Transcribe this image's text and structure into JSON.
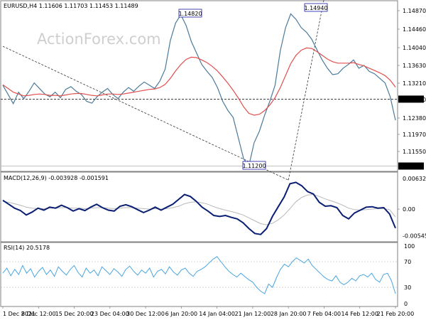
{
  "chart_data": [
    {
      "panel": "price",
      "type": "line",
      "title": "EURUSD,H4  1.11606 1.11703 1.11453 1.11489",
      "watermark": "ActionForex.com",
      "ylim": [
        1.1138,
        1.149
      ],
      "y_ticks": [
        "1.14870",
        "1.14460",
        "1.14040",
        "1.13630",
        "1.13210",
        "1.12800",
        "1.12380",
        "1.11970",
        "1.11550"
      ],
      "x": [
        "1 Dec 2021",
        "8 Dec 12:00",
        "15 Dec 20:00",
        "23 Dec 04:00",
        "30 Dec 12:00",
        "6 Jan 20:00",
        "14 Jan 04:00",
        "21 Jan 12:00",
        "28 Jan 20:00",
        "7 Feb 04:00",
        "14 Feb 12:00",
        "21 Feb 20:00"
      ],
      "series": [
        {
          "name": "close",
          "values": [
            1.1325,
            1.1305,
            1.1285,
            1.131,
            1.1296,
            1.1312,
            1.133,
            1.1318,
            1.1306,
            1.13,
            1.131,
            1.1298,
            1.1316,
            1.1322,
            1.1312,
            1.1305,
            1.129,
            1.1286,
            1.13,
            1.131,
            1.1318,
            1.1305,
            1.1296,
            1.131,
            1.132,
            1.1312,
            1.1323,
            1.1332,
            1.1325,
            1.1318,
            1.1334,
            1.136,
            1.1422,
            1.146,
            1.1478,
            1.1455,
            1.142,
            1.1395,
            1.137,
            1.1355,
            1.1342,
            1.132,
            1.129,
            1.127,
            1.1255,
            1.121,
            1.1165,
            1.115,
            1.12,
            1.1225,
            1.126,
            1.129,
            1.1325,
            1.14,
            1.145,
            1.148,
            1.1468,
            1.145,
            1.144,
            1.1425,
            1.1402,
            1.138,
            1.1362,
            1.1348,
            1.135,
            1.1362,
            1.137,
            1.138,
            1.1362,
            1.1368,
            1.1355,
            1.135,
            1.134,
            1.133,
            1.13,
            1.1249
          ]
        },
        {
          "name": "SMA",
          "values": [
            1.1326,
            1.1318,
            1.131,
            1.1306,
            1.1302,
            1.1303,
            1.1305,
            1.1306,
            1.1305,
            1.1303,
            1.1303,
            1.1302,
            1.1304,
            1.1306,
            1.1307,
            1.1307,
            1.1305,
            1.1303,
            1.1302,
            1.1304,
            1.1306,
            1.1306,
            1.1305,
            1.1306,
            1.1308,
            1.131,
            1.1312,
            1.1314,
            1.1316,
            1.1317,
            1.132,
            1.1327,
            1.134,
            1.1356,
            1.137,
            1.1381,
            1.1386,
            1.1385,
            1.138,
            1.1374,
            1.1366,
            1.1356,
            1.1343,
            1.1329,
            1.1314,
            1.1297,
            1.1278,
            1.1264,
            1.126,
            1.1262,
            1.127,
            1.1282,
            1.1298,
            1.132,
            1.1346,
            1.1372,
            1.139,
            1.1401,
            1.1406,
            1.1405,
            1.1398,
            1.139,
            1.1382,
            1.1376,
            1.1373,
            1.1373,
            1.1373,
            1.1374,
            1.137,
            1.1367,
            1.1362,
            1.1357,
            1.1352,
            1.1346,
            1.1336,
            1.1321
          ]
        }
      ],
      "current_price": {
        "label": "1.11489",
        "value": 1.1149
      },
      "reference_level": {
        "label": "1.12870",
        "value": 1.1287
      },
      "annotations": [
        {
          "label": "1.14820",
          "value": 1.1482
        },
        {
          "label": "1.14940",
          "value": 1.1494
        },
        {
          "label": "1.11200",
          "value": 1.112
        }
      ],
      "trendlines": [
        {
          "from_x": "1 Dec 2021",
          "from_y": 1.1396,
          "to_x": "28 Jan 20:00",
          "to_y": 1.112
        },
        {
          "from_x": "28 Jan 20:00",
          "from_y": 1.112,
          "to_x": "7 Feb 04:00",
          "to_y": 1.1494
        }
      ]
    },
    {
      "panel": "macd",
      "type": "line",
      "title": "MACD(12,26,9) -0.003928 -0.001591",
      "ylim": [
        -0.0067,
        0.0076
      ],
      "y_ticks": [
        "0.00632",
        "0.00",
        "-0.005455"
      ],
      "series": [
        {
          "name": "MACD",
          "values": [
            0.0018,
            0.001,
            0.0002,
            -0.0003,
            -0.0012,
            -0.0006,
            0.0002,
            -0.0002,
            0.0004,
            0.0002,
            0.0008,
            0.0003,
            -0.0004,
            0.0001,
            -0.0003,
            0.0004,
            0.001,
            0.0003,
            -0.0002,
            -0.0004,
            0.0006,
            0.0009,
            0.0005,
            -0.0001,
            -0.0007,
            -0.0002,
            0.0004,
            -0.0002,
            0.0004,
            0.001,
            0.002,
            0.003,
            0.0026,
            0.0016,
            0.0004,
            -0.0004,
            -0.0013,
            -0.0015,
            -0.0013,
            -0.0017,
            -0.002,
            -0.0028,
            -0.004,
            -0.005,
            -0.0052,
            -0.004,
            -0.0015,
            0.0005,
            0.0025,
            0.0052,
            0.0055,
            0.0048,
            0.0036,
            0.0031,
            0.0014,
            0.0006,
            0.0007,
            0.0003,
            -0.0013,
            -0.002,
            -0.0008,
            -0.0002,
            0.0004,
            0.0005,
            0.0002,
            0.0003,
            -0.001,
            -0.0039
          ]
        },
        {
          "name": "Signal",
          "values": [
            0.0016,
            0.0014,
            0.0011,
            0.0008,
            0.0004,
            0.0002,
            0.0001,
            0.0001,
            0.0002,
            0.0002,
            0.0003,
            0.0003,
            0.0002,
            0.0002,
            0.0001,
            0.0002,
            0.0003,
            0.0003,
            0.0002,
            0.0001,
            0.0002,
            0.0003,
            0.0003,
            0.0002,
            0.0001,
            0.0,
            0.0001,
            0.0,
            0.0001,
            0.0003,
            0.0006,
            0.0011,
            0.0014,
            0.0015,
            0.0013,
            0.001,
            0.0005,
            0.0001,
            -0.0002,
            -0.0005,
            -0.0008,
            -0.0012,
            -0.0018,
            -0.0024,
            -0.003,
            -0.0032,
            -0.0029,
            -0.0022,
            -0.0012,
            0.0001,
            0.0015,
            0.0024,
            0.0029,
            0.003,
            0.0026,
            0.0021,
            0.0017,
            0.0013,
            0.0008,
            0.0002,
            -0.0001,
            -0.0002,
            -0.0001,
            0.0,
            0.0001,
            0.0001,
            -0.0001,
            -0.0016
          ]
        }
      ]
    },
    {
      "panel": "rsi",
      "type": "line",
      "title": "RSI(14) 20.5178",
      "ylim": [
        0,
        100
      ],
      "y_ticks": [
        "100",
        "70",
        "30",
        "0"
      ],
      "series": [
        {
          "name": "RSI",
          "values": [
            52,
            60,
            48,
            58,
            50,
            64,
            52,
            59,
            46,
            55,
            61,
            50,
            57,
            47,
            62,
            55,
            49,
            58,
            64,
            53,
            46,
            60,
            52,
            57,
            48,
            62,
            56,
            50,
            59,
            54,
            47,
            58,
            63,
            55,
            49,
            57,
            52,
            60,
            46,
            55,
            58,
            51,
            62,
            54,
            49,
            57,
            60,
            52,
            47,
            55,
            58,
            62,
            68,
            74,
            78,
            70,
            62,
            55,
            50,
            46,
            52,
            47,
            42,
            38,
            30,
            24,
            20,
            35,
            30,
            45,
            58,
            66,
            62,
            70,
            76,
            72,
            68,
            74,
            64,
            58,
            52,
            46,
            42,
            40,
            48,
            38,
            34,
            38,
            44,
            40,
            48,
            50,
            46,
            52,
            42,
            38,
            50,
            52,
            40,
            20
          ]
        }
      ]
    }
  ],
  "colors": {
    "price": "#4a7a99",
    "sma": "#e05050",
    "macd": "#0a1f73",
    "signal": "#b8b8b8",
    "rsi": "#4aa6e0",
    "frame": "#808080",
    "gridline": "#000000"
  }
}
